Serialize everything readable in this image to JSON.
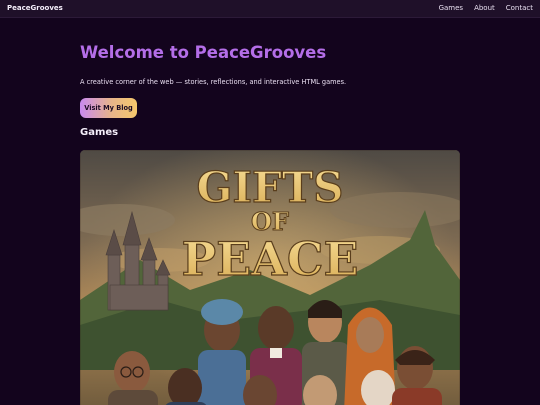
{
  "nav": {
    "brand": "PeaceGrooves",
    "links": [
      "Games",
      "About",
      "Contact"
    ]
  },
  "hero": {
    "title": "Welcome to PeaceGrooves",
    "subtitle": "A creative corner of the web — stories, reflections, and interactive HTML games.",
    "blog_button": "Visit My Blog"
  },
  "games": {
    "heading": "Games",
    "items": [
      {
        "title_line1": "GIFTS",
        "title_line2": "OF",
        "title_line3": "PEACE"
      }
    ]
  },
  "colors": {
    "background": "#13041d",
    "navbar": "#1f1029",
    "accent_title": "#b46ee8",
    "button_gradient_start": "#c98af0",
    "button_gradient_end": "#f5c86b"
  }
}
